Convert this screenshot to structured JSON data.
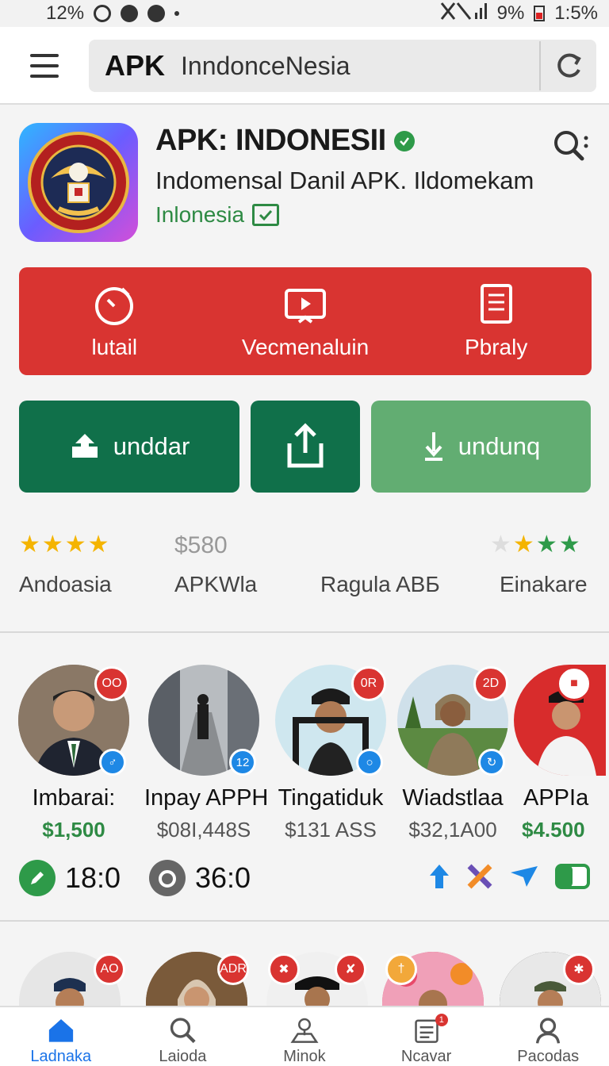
{
  "status_bar": {
    "left_text": "12%",
    "battery": "9%",
    "time": "1:5%"
  },
  "top_bar": {
    "brand": "APK",
    "search_query": "InndonceNesia"
  },
  "app": {
    "title": "APK: INDONESII",
    "subtitle": "Indomensal Danil APK. Ildomekam",
    "region": "Inlonesia",
    "icon_text_top": "PIDEUSJNAS",
    "icon_text_bottom": "ATEBAN VIIUNAI"
  },
  "actions": [
    {
      "label": "lutail",
      "icon": "timer-icon"
    },
    {
      "label": "Vecmenaluin",
      "icon": "play-screen-icon"
    },
    {
      "label": "Pbraly",
      "icon": "document-icon"
    }
  ],
  "buttons": {
    "primary_label": "unddar",
    "secondary_label": "undunq"
  },
  "ratings": {
    "left_stars": 3.5,
    "price": "$580",
    "labels": [
      "Andoasia",
      "APKWla",
      "Ragula ABБ",
      "Einakare"
    ]
  },
  "people": [
    {
      "name": "Imbarai:",
      "price": "$1,500",
      "highlight": true,
      "badge_top": "OO",
      "badge_bottom": "♂",
      "bg": "#7a6a5a"
    },
    {
      "name": "Inpay APPH",
      "price": "$08I,448S",
      "highlight": false,
      "badge_top": "",
      "badge_bottom": "12",
      "bg": "#9a9a9a"
    },
    {
      "name": "Tingatiduk",
      "price": "$131 ASS",
      "highlight": false,
      "badge_top": "0R",
      "badge_bottom": "○",
      "bg": "#9ccde0"
    },
    {
      "name": "Wiadstlaa",
      "price": "$32,1A00",
      "highlight": false,
      "badge_top": "2D",
      "badge_bottom": "↻",
      "bg": "#6f9a5a"
    },
    {
      "name": "APPIa",
      "price": "$4.500",
      "highlight": true,
      "badge_top": "■",
      "badge_bottom": "",
      "bg": "#d82c2c"
    }
  ],
  "stats": {
    "left_value": "18:0",
    "right_value": "36:0"
  },
  "second_row_badges": [
    "AO",
    "ADR",
    "✖",
    "✘",
    "†",
    "✱"
  ],
  "bottom_nav": [
    {
      "label": "Ladnaka",
      "icon": "home-icon",
      "active": true
    },
    {
      "label": "Laioda",
      "icon": "search-icon",
      "active": false
    },
    {
      "label": "Minok",
      "icon": "map-pin-icon",
      "active": false
    },
    {
      "label": "Ncavar",
      "icon": "calendar-icon",
      "active": false,
      "badge": "1"
    },
    {
      "label": "Pacodas",
      "icon": "person-icon",
      "active": false
    }
  ],
  "colors": {
    "red": "#d93431",
    "dark_green": "#10704a",
    "light_green": "#62ad72",
    "accent_blue": "#1a73e8"
  }
}
